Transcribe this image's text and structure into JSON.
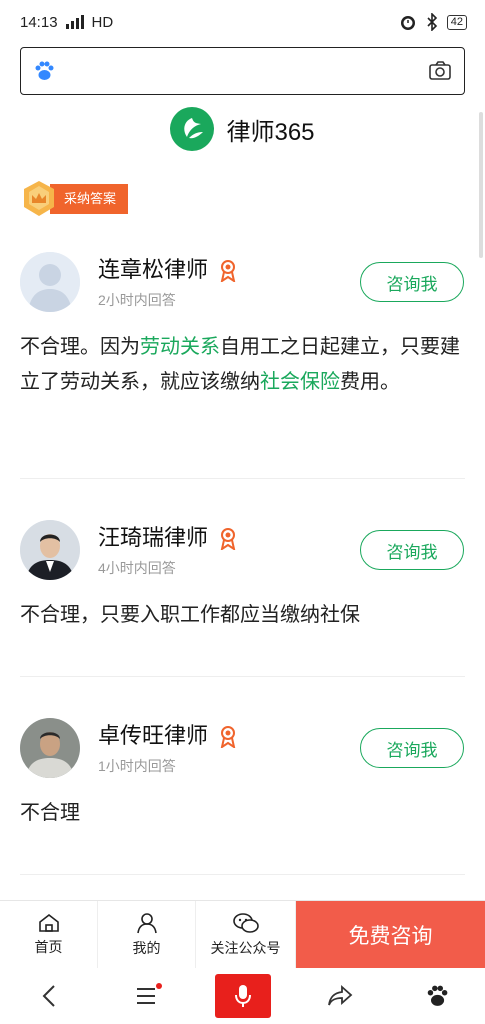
{
  "status_bar": {
    "time": "14:13",
    "network": "HD",
    "battery": "42"
  },
  "brand": {
    "name": "律师365"
  },
  "adopted_badge": {
    "label": "采纳答案"
  },
  "answers": [
    {
      "name": "连章松律师",
      "time": "2小时内回答",
      "consult_label": "咨询我",
      "text_parts": [
        "不合理。因为",
        "劳动关系",
        "自用工之日起建立，只要建立了劳动关系，就应该缴纳",
        "社会保险",
        "费用。"
      ]
    },
    {
      "name": "汪琦瑞律师",
      "time": "4小时内回答",
      "consult_label": "咨询我",
      "text": "不合理，只要入职工作都应当缴纳社保"
    },
    {
      "name": "卓传旺律师",
      "time": "1小时内回答",
      "consult_label": "咨询我",
      "text": "不合理"
    }
  ],
  "bottom_nav": {
    "home": "首页",
    "mine": "我的",
    "follow": "关注公众号",
    "free_consult": "免费咨询"
  },
  "colors": {
    "accent": "#1aa85c",
    "cta": "#f25c4a",
    "badge": "#f0642c"
  }
}
